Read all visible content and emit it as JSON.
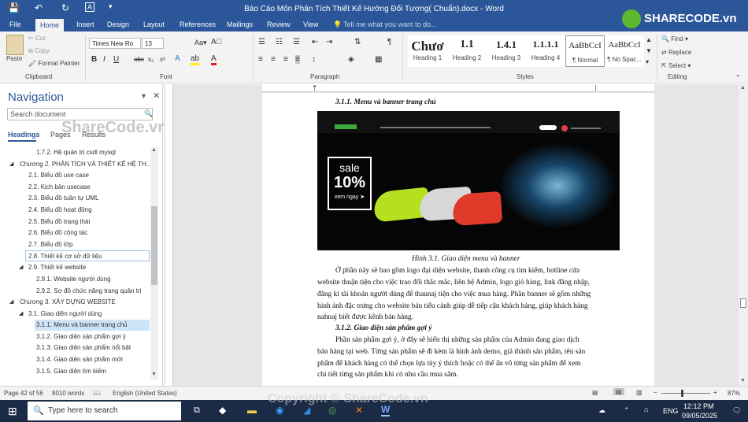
{
  "titlebar": {
    "title": "Báo Cáo Môn Phân Tích Thiết Kế Hướng Đối Tượng( Chuẩn).docx - Word"
  },
  "tabs": [
    "File",
    "Home",
    "Insert",
    "Design",
    "Layout",
    "References",
    "Mailings",
    "Review",
    "View"
  ],
  "tellme": "Tell me what you want to do...",
  "clipboard": {
    "paste": "Paste",
    "cut": "Cut",
    "copy": "Copy",
    "painter": "Format Painter",
    "label": "Clipboard"
  },
  "font": {
    "name": "Times New Ro",
    "size": "13",
    "label": "Font"
  },
  "paragraph": {
    "label": "Paragraph"
  },
  "styles": {
    "label": "Styles",
    "items": [
      {
        "sample": "Chươ",
        "name": "Heading 1"
      },
      {
        "sample": "1.1",
        "name": "Heading 2"
      },
      {
        "sample": "1.4.1",
        "name": "Heading 3"
      },
      {
        "sample": "1.1.1.1",
        "name": "Heading 4"
      },
      {
        "sample": "AaBbCcI",
        "name": "¶ Normal"
      },
      {
        "sample": "AaBbCcI",
        "name": "¶ No Spac..."
      }
    ]
  },
  "editing": {
    "find": "Find",
    "replace": "Replace",
    "select": "Select",
    "label": "Editing"
  },
  "nav": {
    "title": "Navigation",
    "search_placeholder": "Search document",
    "tabs": [
      "Headings",
      "Pages",
      "Results"
    ],
    "items": [
      "1.7.2. Hệ quản trị csdl mysql",
      "Chương 2. PHÂN TÍCH VÀ THIẾT KẾ HỆ TH...",
      "2.1. Biểu đồ use case",
      "2.2. Kịch bản usecase",
      "2.3. Biểu đồ tuần tự UML",
      "2.4. Biểu đồ hoạt động",
      "2.5. Biểu đồ trạng thái",
      "2.6. Biểu đồ cộng tác",
      "2.7. Biểu đồ lớp",
      "2.8. Thiết kế cơ sở dữ liệu",
      "2.9. Thiết kế website",
      "2.9.1. Website người dùng",
      "2.9.2. Sơ đồ chức năng trang quản trị",
      "Chương 3. XÂY DỰNG WEBSITE",
      "3.1. Giao diện người dùng",
      "3.1.1. Menu và banner trang chủ",
      "3.1.2. Giao diện sản phẩm gợi ý",
      "3.1.3. Giao diện sản phẩm nổi bật",
      "3.1.4. Giao diện sản phẩm mới",
      "3.1.5. Giao diện tìm kiếm"
    ]
  },
  "doc": {
    "heading1": "3.1.1. Menu và banner trang chủ",
    "banner": {
      "sale": "sale",
      "percent": "10%",
      "cta": "xem ngay ➤"
    },
    "caption": "Hình 3.1. Giao diện menu và banner",
    "para1": [
      "Ở phần này sẽ bao gồm logo đại diện website, thanh công cụ tìm kiếm, hotline cửa",
      "website thuận tiện cho việc trao đổi thắc mắc, liên hệ Admin, logo giỏ hàng, link đăng nhập,",
      "đăng kí tài khoản người dùng để thaunaj tiện cho việc mua hàng. Phần banner sẽ gồm những",
      "hình ảnh đặc trưng cho website bán tiểu cảnh giúp dễ tiếp cận khách hàng, giúp khách hàng",
      "nahnaj biết được kênh bán hàng."
    ],
    "heading2": "3.1.2. Giao diện sản phẩm gợi ý",
    "para2": [
      "Phần sản phẩm gợi ý, ở đây sẽ hiển thị những sản phẩm của Admin đang giao dịch",
      "bán hàng tại web. Từng sản phẩm sẽ đi kèm là hình ảnh demo, giá thành sản phẩm, tên sản",
      "phẩm để khách hàng có thể chọn lựa tùy ý thích hoặc có thể ấn vô từng sản phẩm để xem",
      "chi tiết từng sản phẩm khi có nhu cầu mua sắm."
    ]
  },
  "status": {
    "page": "Page 42 of 56",
    "words": "8010 words",
    "lang": "English (United States)",
    "zoom": "87%"
  },
  "taskbar": {
    "search": "Type here to search",
    "lang": "ENG",
    "time": "12:12 PM",
    "date": "09/05/2025"
  },
  "watermarks": {
    "logo": "SHARECODE.vn",
    "left": "ShareCode.vn",
    "bottom": "Copyright © ShareCode.vn"
  }
}
